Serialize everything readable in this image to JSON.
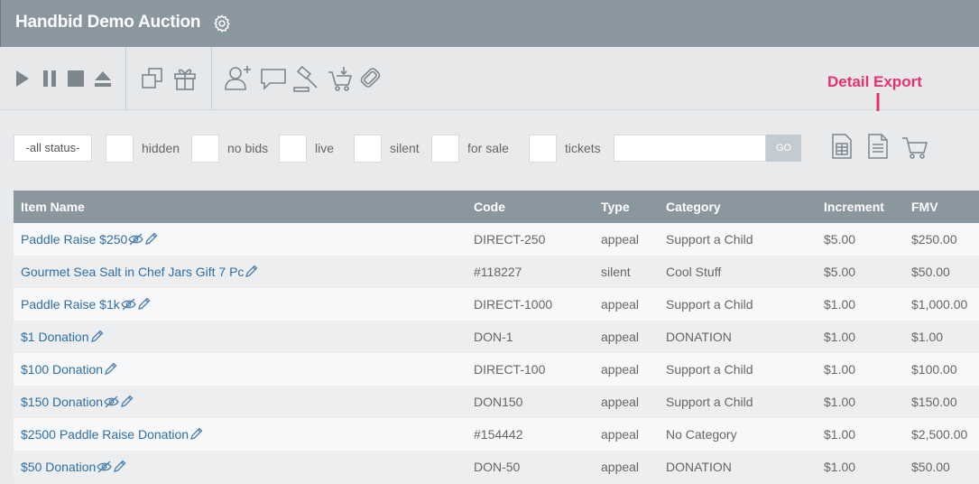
{
  "header": {
    "title": "Handbid Demo Auction"
  },
  "filters": {
    "status": "-all status-",
    "checkboxes": [
      {
        "label": "hidden"
      },
      {
        "label": "no bids"
      },
      {
        "label": "live"
      },
      {
        "label": "silent"
      },
      {
        "label": "for sale"
      },
      {
        "label": "tickets"
      }
    ],
    "search_value": "",
    "go_label": "GO"
  },
  "annotation": {
    "text": "Detail Export",
    "color": "#e8316c"
  },
  "table": {
    "headers": [
      "Item Name",
      "Code",
      "Type",
      "Category",
      "Increment",
      "FMV"
    ],
    "rows": [
      {
        "name": "Paddle Raise $250",
        "hidden_icon": true,
        "code": "DIRECT-250",
        "type": "appeal",
        "category": "Support a Child",
        "increment": "$5.00",
        "fmv": "$250.00"
      },
      {
        "name": "Gourmet Sea Salt in Chef Jars Gift 7 Pc",
        "hidden_icon": false,
        "code": "#118227",
        "type": "silent",
        "category": "Cool Stuff",
        "increment": "$5.00",
        "fmv": "$50.00"
      },
      {
        "name": "Paddle Raise $1k",
        "hidden_icon": true,
        "code": "DIRECT-1000",
        "type": "appeal",
        "category": "Support a Child",
        "increment": "$1.00",
        "fmv": "$1,000.00"
      },
      {
        "name": "$1 Donation",
        "hidden_icon": false,
        "code": "DON-1",
        "type": "appeal",
        "category": "DONATION",
        "increment": "$1.00",
        "fmv": "$1.00"
      },
      {
        "name": "$100 Donation",
        "hidden_icon": false,
        "code": "DIRECT-100",
        "type": "appeal",
        "category": "Support a Child",
        "increment": "$1.00",
        "fmv": "$100.00"
      },
      {
        "name": "$150 Donation",
        "hidden_icon": true,
        "code": "DON150",
        "type": "appeal",
        "category": "Support a Child",
        "increment": "$1.00",
        "fmv": "$150.00"
      },
      {
        "name": "$2500 Paddle Raise Donation",
        "hidden_icon": false,
        "code": "#154442",
        "type": "appeal",
        "category": "No Category",
        "increment": "$1.00",
        "fmv": "$2,500.00"
      },
      {
        "name": "$50 Donation",
        "hidden_icon": true,
        "code": "DON-50",
        "type": "appeal",
        "category": "DONATION",
        "increment": "$1.00",
        "fmv": "$50.00"
      }
    ]
  },
  "colors": {
    "header_bg": "#8b979f",
    "link": "#2f6ea5",
    "toolbar_icon": "#7b868d"
  }
}
